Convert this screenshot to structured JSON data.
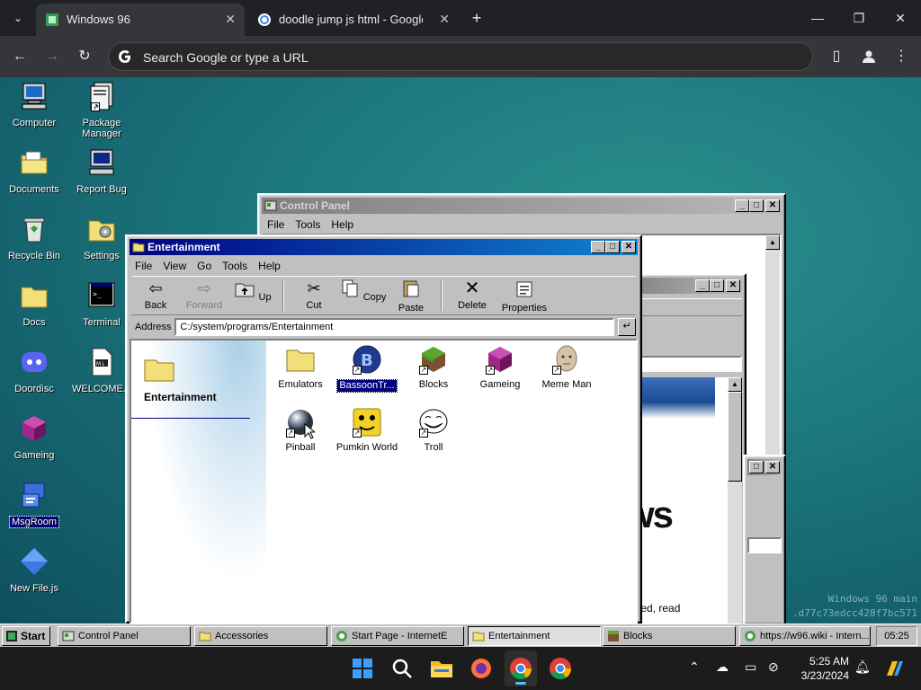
{
  "browser": {
    "tabs": [
      {
        "title": "Windows 96",
        "active": true
      },
      {
        "title": "doodle jump js html - Google S",
        "active": false
      }
    ],
    "omnibox_placeholder": "Search Google or type a URL"
  },
  "desktop": {
    "icons": [
      {
        "label": "Computer"
      },
      {
        "label": "Package Manager"
      },
      {
        "label": "Documents"
      },
      {
        "label": "Report Bug"
      },
      {
        "label": "Recycle Bin"
      },
      {
        "label": "Settings"
      },
      {
        "label": "Docs"
      },
      {
        "label": "Terminal"
      },
      {
        "label": "Doordisc"
      },
      {
        "label": "WELCOME..."
      },
      {
        "label": "Gameing"
      },
      {
        "label": "MsgRoom"
      },
      {
        "label": "New File.js"
      }
    ],
    "watermark_line1": "Windows 96 main",
    "watermark_line2": ".d77c73edcc428f7bc571"
  },
  "control_panel": {
    "title": "Control Panel",
    "menu": [
      "File",
      "Tools",
      "Help"
    ]
  },
  "bg_window": {
    "partial_text_1": "ws",
    "partial_text_2": "tarted, read"
  },
  "explorer": {
    "title": "Entertainment",
    "menu": [
      "File",
      "View",
      "Go",
      "Tools",
      "Help"
    ],
    "toolbar": [
      {
        "label": "Back"
      },
      {
        "label": "Forward"
      },
      {
        "label": "Up"
      },
      {
        "label": "Cut"
      },
      {
        "label": "Copy"
      },
      {
        "label": "Paste"
      },
      {
        "label": "Delete"
      },
      {
        "label": "Properties"
      }
    ],
    "address_label": "Address",
    "address_value": "C:/system/programs/Entertainment",
    "go_label": "↵",
    "side_title": "Entertainment",
    "items": [
      {
        "label": "Emulators"
      },
      {
        "label": "BassoonTr..."
      },
      {
        "label": "Blocks"
      },
      {
        "label": "Gameing"
      },
      {
        "label": "Meme Man"
      },
      {
        "label": "Pinball"
      },
      {
        "label": "Pumkin World"
      },
      {
        "label": "Troll"
      }
    ]
  },
  "taskbar96": {
    "start_label": "Start",
    "items": [
      {
        "label": "Control Panel"
      },
      {
        "label": "Accessories"
      },
      {
        "label": "Start Page - InternetE"
      },
      {
        "label": "Entertainment"
      },
      {
        "label": "Blocks"
      },
      {
        "label": "https://w96.wiki - Intern..."
      }
    ],
    "clock": "05:25"
  },
  "win11": {
    "time": "5:25 AM",
    "date": "3/23/2024"
  }
}
